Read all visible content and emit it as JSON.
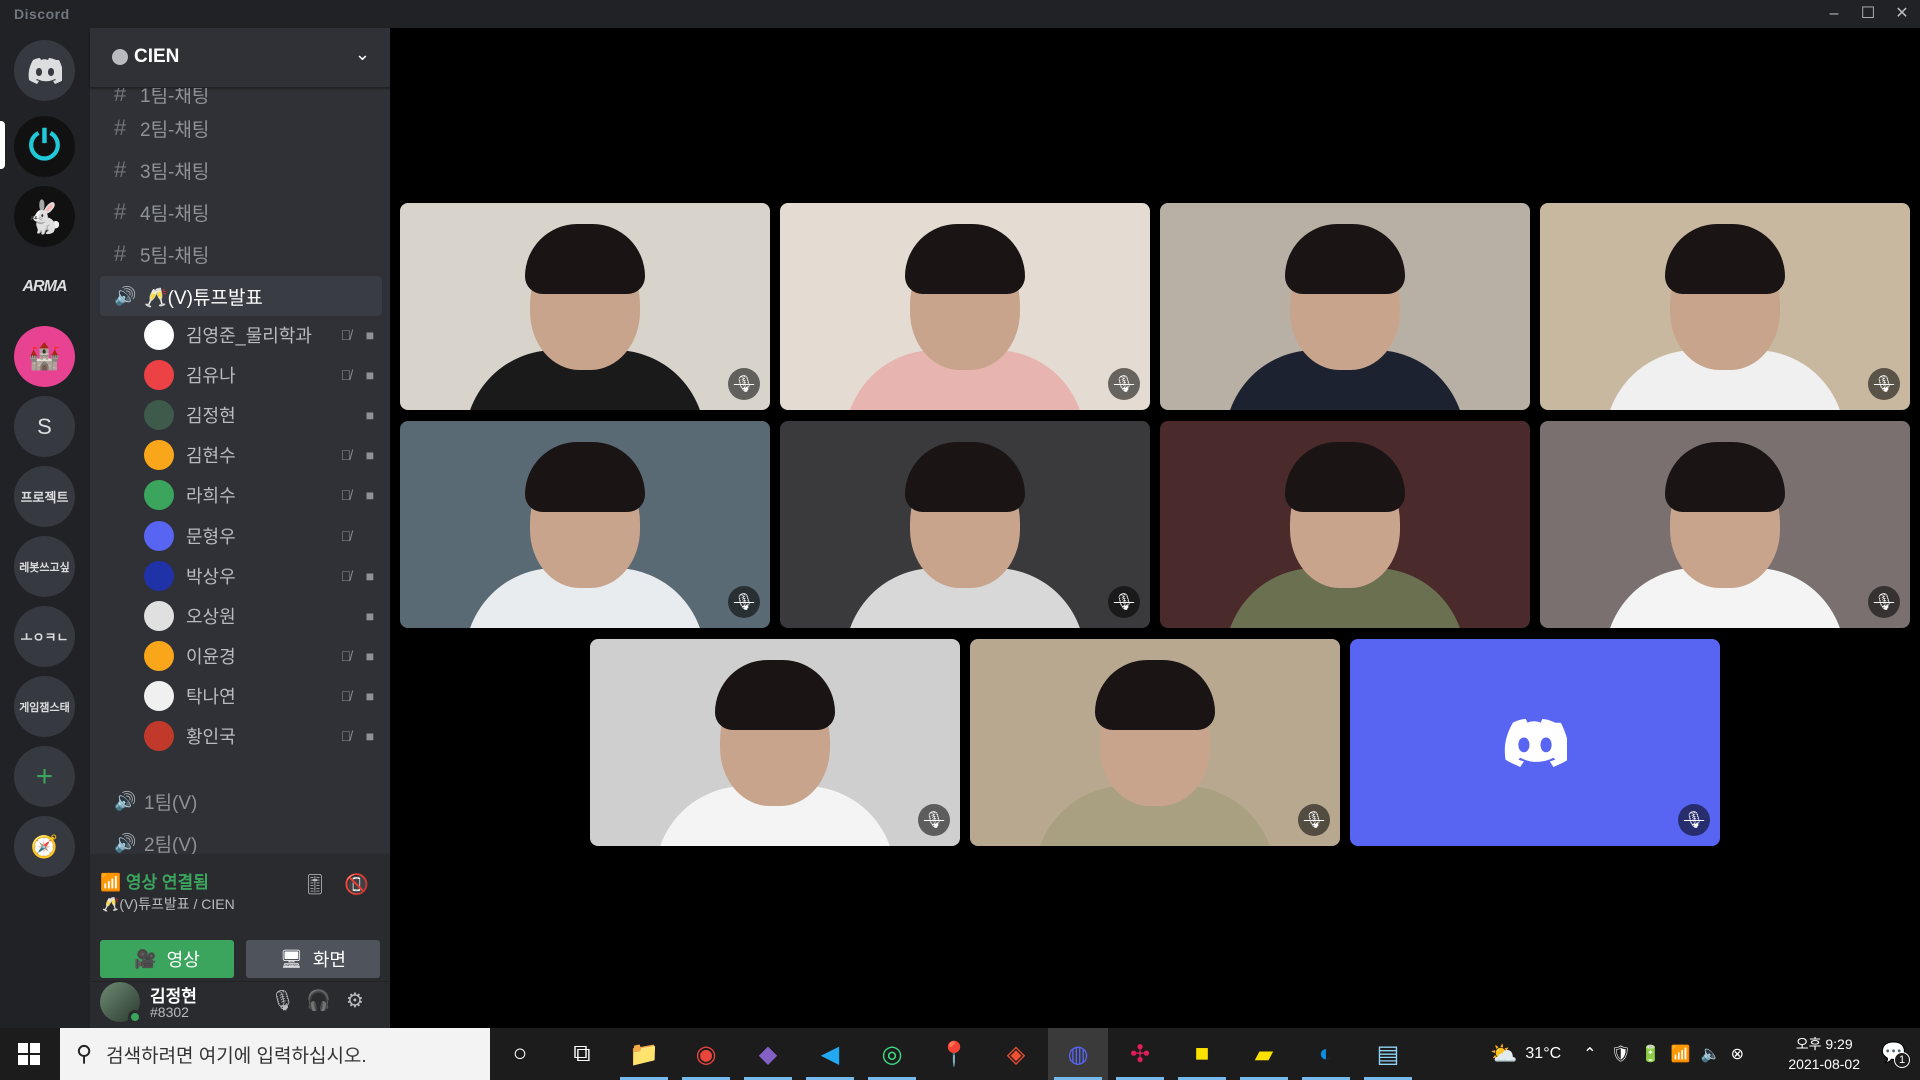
{
  "window": {
    "title": "Discord",
    "controls": [
      "–",
      "☐",
      "✕"
    ]
  },
  "servers": [
    {
      "name": "discord-home",
      "label": "",
      "color": "#36393f"
    },
    {
      "name": "power-server",
      "label": "",
      "color": "#1a1a1a"
    },
    {
      "name": "rabbit-server",
      "label": "",
      "color": "#1a1a1a"
    },
    {
      "name": "arma-server",
      "label": "ARMA",
      "color": "#202225"
    },
    {
      "name": "pink-server",
      "label": "",
      "color": "#e84393"
    },
    {
      "name": "s-server",
      "label": "S",
      "color": "#36393f"
    },
    {
      "name": "project-server",
      "label": "프로젝트",
      "color": "#36393f"
    },
    {
      "name": "robot-server",
      "label": "레봇쓰고싶",
      "color": "#36393f"
    },
    {
      "name": "ㅗㅇㅋㄴ-server",
      "label": "ㅗㅇㅋㄴ",
      "color": "#36393f"
    },
    {
      "name": "gamejam-server",
      "label": "게임잼스태",
      "color": "#36393f"
    },
    {
      "name": "add-server",
      "label": "+",
      "color": "#36393f"
    },
    {
      "name": "explore",
      "label": "🧭",
      "color": "#36393f"
    }
  ],
  "guild": {
    "name": "CIEN"
  },
  "text_channels": [
    "1팀-채팅",
    "2팀-채팅",
    "3팀-채팅",
    "4팀-채팅",
    "5팀-채팅"
  ],
  "active_voice_channel": "🥂(V)튜프발표",
  "voice_users": [
    {
      "name": "김영준_물리학과",
      "color": "#ffffff",
      "muted": true,
      "video": true
    },
    {
      "name": "김유나",
      "color": "#ed4245",
      "muted": true,
      "video": true
    },
    {
      "name": "김정현",
      "color": "#3d5a4a",
      "muted": false,
      "video": true
    },
    {
      "name": "김현수",
      "color": "#faa61a",
      "muted": true,
      "video": true
    },
    {
      "name": "라희수",
      "color": "#3ba55d",
      "muted": true,
      "video": true
    },
    {
      "name": "문형우",
      "color": "#5865f2",
      "muted": true,
      "video": false
    },
    {
      "name": "박상우",
      "color": "#2032a8",
      "muted": true,
      "video": true
    },
    {
      "name": "오상원",
      "color": "#e0e0e0",
      "muted": false,
      "video": true
    },
    {
      "name": "이윤경",
      "color": "#faa61a",
      "muted": true,
      "video": true
    },
    {
      "name": "탁나연",
      "color": "#f0f0f0",
      "muted": true,
      "video": true
    },
    {
      "name": "황인국",
      "color": "#c0392b",
      "muted": true,
      "video": true
    }
  ],
  "other_voice_channels": [
    "1팀(V)",
    "2팀(V)"
  ],
  "voice_panel": {
    "status": "영상 연결됨",
    "location": "🥂(V)튜프발표 / CIEN",
    "video_button": "영상",
    "screen_button": "화면"
  },
  "user": {
    "name": "김정현",
    "tag": "#8302"
  },
  "video_tiles": [
    {
      "bg": "#d8d4cc",
      "shirt": "#1a1a1a",
      "muted": true
    },
    {
      "bg": "#e4dcd2",
      "shirt": "#e8b4b0",
      "muted": true
    },
    {
      "bg": "#b8b0a4",
      "shirt": "#1c2230",
      "muted": false
    },
    {
      "bg": "#c8b8a0",
      "shirt": "#f0f0f0",
      "muted": true
    },
    {
      "bg": "#5a6a74",
      "shirt": "#e8ecef",
      "muted": true
    },
    {
      "bg": "#3a3a3c",
      "shirt": "#d8d8d8",
      "muted": true
    },
    {
      "bg": "#4a2a2a",
      "shirt": "#6a7050",
      "muted": false
    },
    {
      "bg": "#7a7070",
      "shirt": "#f4f4f4",
      "muted": true
    },
    {
      "bg": "#cfcfcf",
      "shirt": "#f4f4f4",
      "muted": true
    },
    {
      "bg": "#b8a890",
      "shirt": "#a8a080",
      "muted": true
    },
    {
      "bg": "#5865f2",
      "shirt": "",
      "muted": true,
      "placeholder": true
    }
  ],
  "taskbar": {
    "search_placeholder": "검색하려면 여기에 입력하십시오.",
    "apps": [
      "cortana",
      "task-view",
      "file-explorer",
      "chrome",
      "visual-studio",
      "vscode",
      "android-studio",
      "maps",
      "git",
      "discord",
      "slack",
      "kakaotalk",
      "sticky-notes",
      "edge",
      "notepad"
    ],
    "weather": "31°C",
    "time_line1": "오후 9:29",
    "time_line2": "2021-08-02",
    "notifications": "1"
  }
}
